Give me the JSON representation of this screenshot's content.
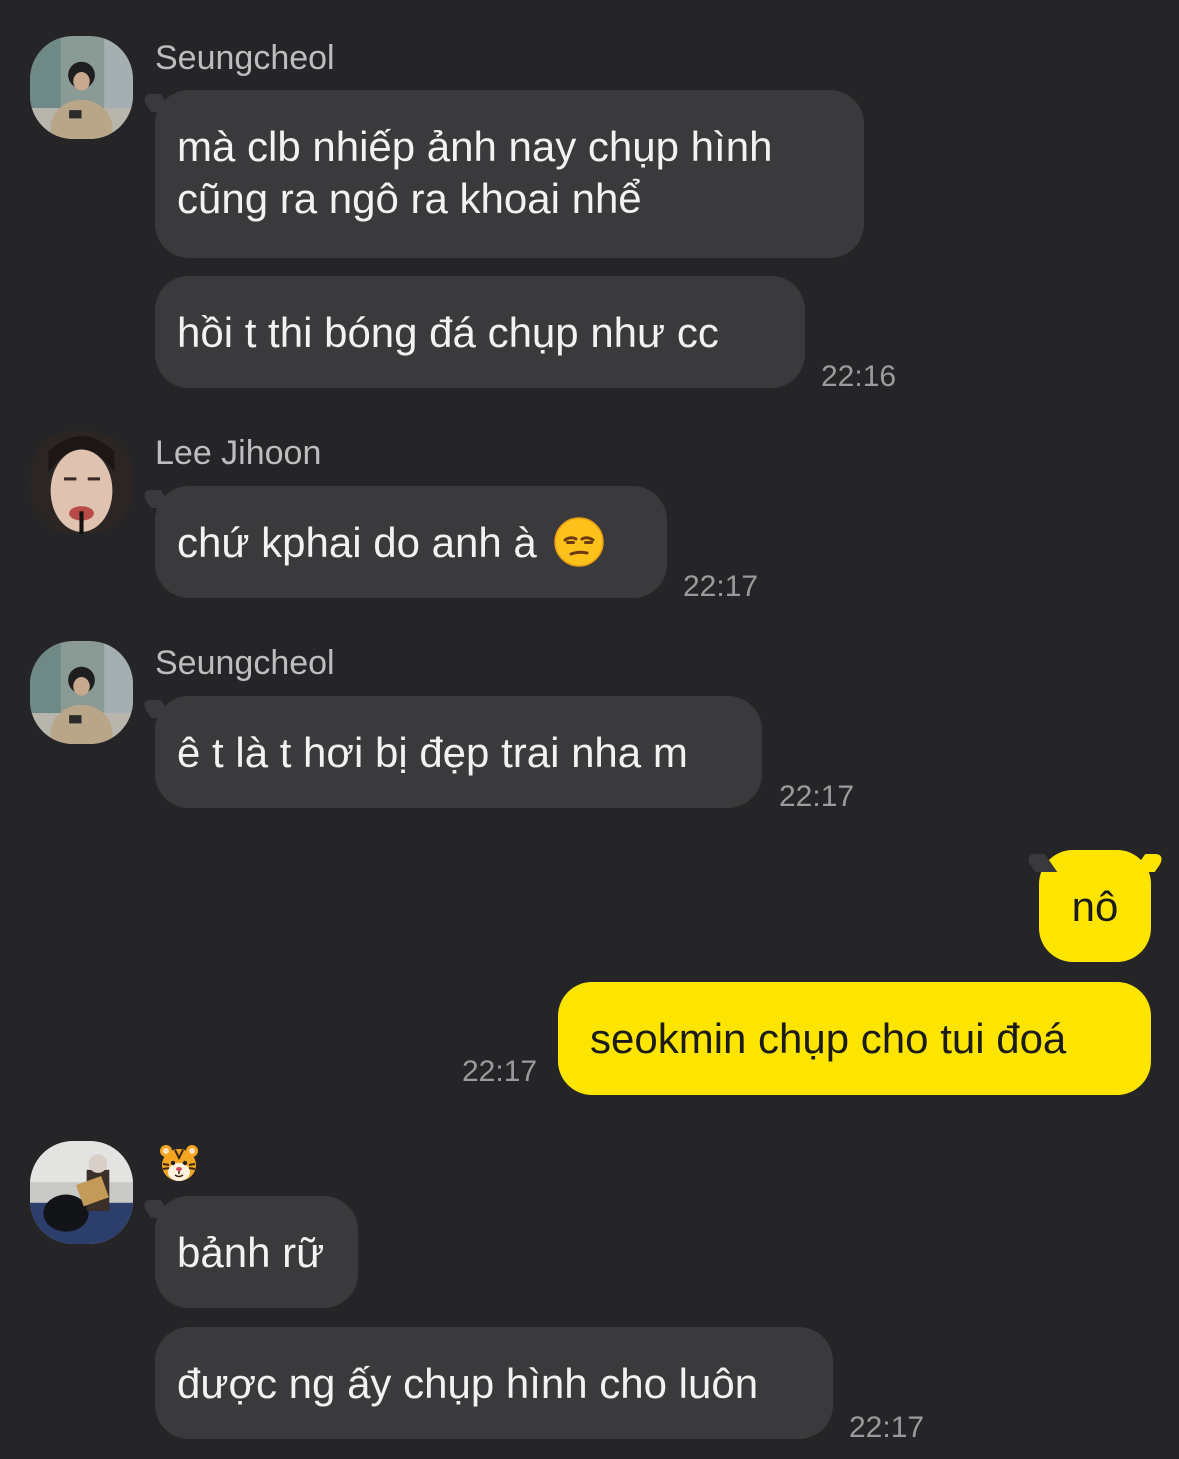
{
  "messages": {
    "m1": {
      "sender": "Seungcheol",
      "line1": "mà clb nhiếp ảnh nay chụp hình",
      "line2": "cũng ra ngô ra khoai nhể",
      "text2": "hồi t thi bóng đá chụp như cc",
      "time": "22:16"
    },
    "m2": {
      "sender": "Lee Jihoon",
      "text": "chứ kphai do anh à",
      "emoji": "unamused-face-emoji",
      "time": "22:17"
    },
    "m3": {
      "sender": "Seungcheol",
      "text": "ê t là t hơi bị đẹp trai nha m",
      "time": "22:17"
    },
    "mine": {
      "text1": "nô",
      "text2": "seokmin chụp cho tui đoá",
      "time": "22:17"
    },
    "m4": {
      "sender_icon": "tiger-face-emoji",
      "text1": "bảnh rữ",
      "text2": "được ng ấy chụp hình cho luôn",
      "time": "22:17"
    }
  },
  "colors": {
    "background": "#252527",
    "incoming_bubble": "#3a3a3c",
    "outgoing_bubble": "#fee500"
  }
}
